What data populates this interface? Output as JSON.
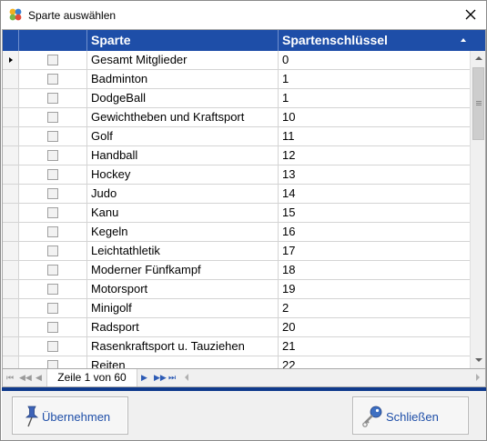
{
  "window": {
    "title": "Sparte auswählen"
  },
  "grid": {
    "columns": [
      "Sparte",
      "Spartenschlüssel"
    ],
    "sort": "ascending",
    "rows": [
      {
        "sparte": "Gesamt Mitglieder",
        "key": "0"
      },
      {
        "sparte": "Badminton",
        "key": "1"
      },
      {
        "sparte": "DodgeBall",
        "key": "1"
      },
      {
        "sparte": "Gewichtheben und Kraftsport",
        "key": "10"
      },
      {
        "sparte": "Golf",
        "key": "11"
      },
      {
        "sparte": "Handball",
        "key": "12"
      },
      {
        "sparte": "Hockey",
        "key": "13"
      },
      {
        "sparte": "Judo",
        "key": "14"
      },
      {
        "sparte": "Kanu",
        "key": "15"
      },
      {
        "sparte": "Kegeln",
        "key": "16"
      },
      {
        "sparte": "Leichtathletik",
        "key": "17"
      },
      {
        "sparte": "Moderner Fünfkampf",
        "key": "18"
      },
      {
        "sparte": "Motorsport",
        "key": "19"
      },
      {
        "sparte": "Minigolf",
        "key": "2"
      },
      {
        "sparte": "Radsport",
        "key": "20"
      },
      {
        "sparte": "Rasenkraftsport u. Tauziehen",
        "key": "21"
      },
      {
        "sparte": "Reiten",
        "key": "22"
      }
    ]
  },
  "navigator": {
    "page_label": "Zeile 1 von 60"
  },
  "buttons": {
    "apply_label": "Übernehmen",
    "close_label": "Schließen"
  },
  "colors": {
    "header_bg": "#1e4ea8",
    "separator": "#0f3a8c",
    "button_text": "#1e4ea8"
  },
  "icons": {
    "app": "app-logo-icon",
    "close": "close-icon",
    "apply": "pushpin-icon",
    "close_button": "key-icon"
  }
}
